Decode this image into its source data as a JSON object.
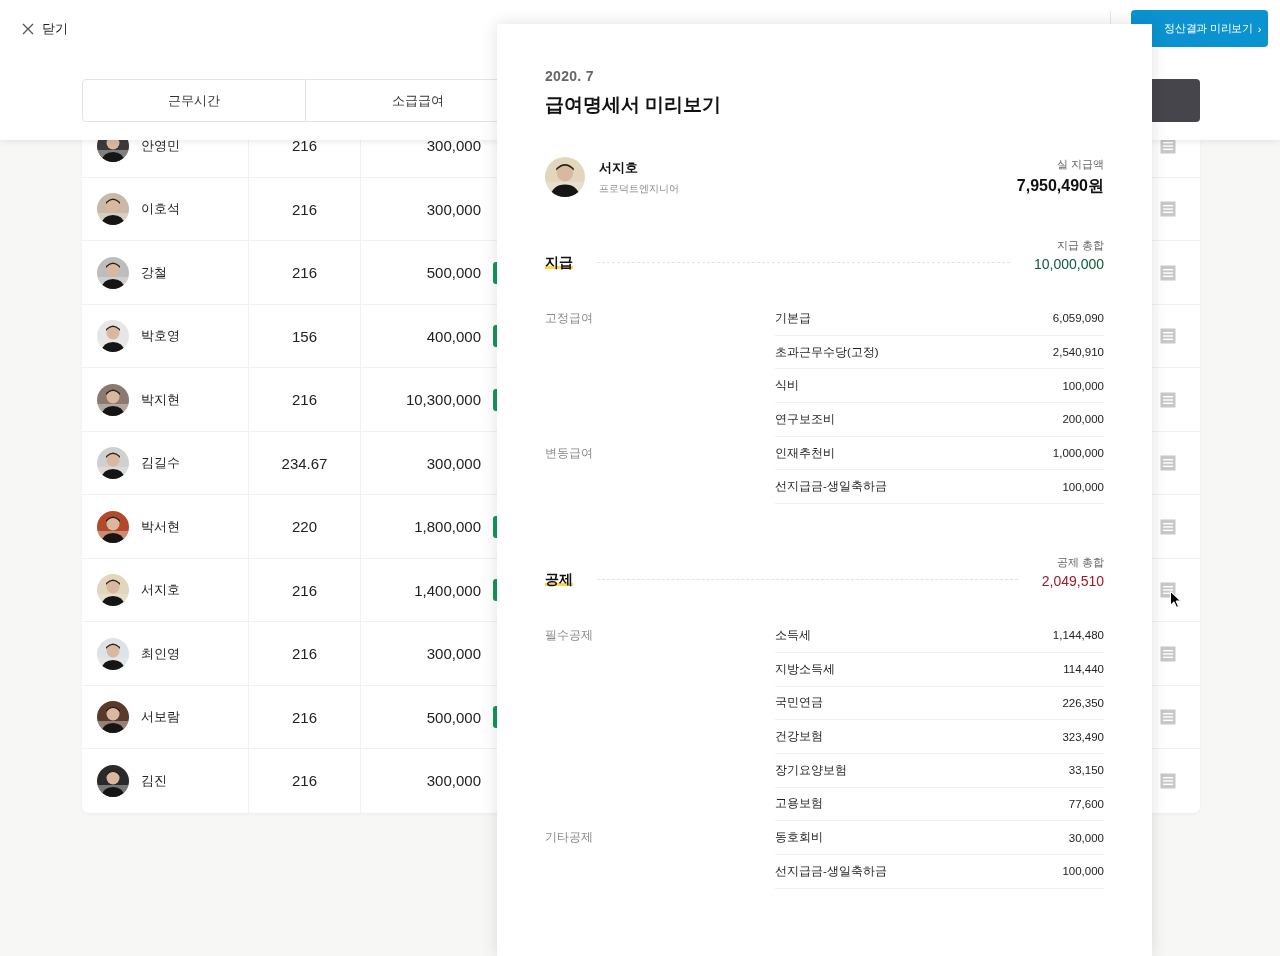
{
  "header": {
    "close_label": "닫기",
    "tabs": [
      "근무시간",
      "소급급여"
    ],
    "preview_button": "정산결과 미리보기",
    "preview_chevron": "›"
  },
  "rows": [
    {
      "name": "안영민",
      "hours": "216",
      "amount": "300,000",
      "badge": false
    },
    {
      "name": "이호석",
      "hours": "216",
      "amount": "300,000",
      "badge": false
    },
    {
      "name": "강철",
      "hours": "216",
      "amount": "500,000",
      "badge": true
    },
    {
      "name": "박호영",
      "hours": "156",
      "amount": "400,000",
      "badge": true
    },
    {
      "name": "박지현",
      "hours": "216",
      "amount": "10,300,000",
      "badge": true
    },
    {
      "name": "김길수",
      "hours": "234.67",
      "amount": "300,000",
      "badge": false
    },
    {
      "name": "박서현",
      "hours": "220",
      "amount": "1,800,000",
      "badge": true
    },
    {
      "name": "서지호",
      "hours": "216",
      "amount": "1,400,000",
      "badge": true
    },
    {
      "name": "최인영",
      "hours": "216",
      "amount": "300,000",
      "badge": false
    },
    {
      "name": "서보람",
      "hours": "216",
      "amount": "500,000",
      "badge": true
    },
    {
      "name": "김진",
      "hours": "216",
      "amount": "300,000",
      "badge": false
    }
  ],
  "payslip": {
    "period": "2020. 7",
    "title": "급여명세서 미리보기",
    "employee": {
      "name": "서지호",
      "role": "프로덕트엔지니어"
    },
    "net_label": "실 지급액",
    "net_amount": "7,950,490원",
    "sections": [
      {
        "title": "지급",
        "total_label": "지급 총합",
        "total": "10,000,000",
        "color": "#0b5a3a",
        "groups": [
          {
            "label": "고정급여",
            "items": [
              {
                "name": "기본급",
                "amount": "6,059,090"
              },
              {
                "name": "초과근무수당(고정)",
                "amount": "2,540,910"
              },
              {
                "name": "식비",
                "amount": "100,000"
              },
              {
                "name": "연구보조비",
                "amount": "200,000"
              }
            ]
          },
          {
            "label": "변동급여",
            "items": [
              {
                "name": "인재추천비",
                "amount": "1,000,000"
              },
              {
                "name": "선지급금-생일축하금",
                "amount": "100,000"
              }
            ]
          }
        ]
      },
      {
        "title": "공제",
        "total_label": "공제 총합",
        "total": "2,049,510",
        "color": "#a3172b",
        "groups": [
          {
            "label": "필수공제",
            "items": [
              {
                "name": "소득세",
                "amount": "1,144,480"
              },
              {
                "name": "지방소득세",
                "amount": "114,440"
              },
              {
                "name": "국민연금",
                "amount": "226,350"
              },
              {
                "name": "건강보험",
                "amount": "323,490"
              },
              {
                "name": "장기요양보험",
                "amount": "33,150"
              },
              {
                "name": "고용보험",
                "amount": "77,600"
              }
            ]
          },
          {
            "label": "기타공제",
            "items": [
              {
                "name": "동호회비",
                "amount": "30,000"
              },
              {
                "name": "선지급금-생일축하금",
                "amount": "100,000"
              }
            ]
          }
        ]
      }
    ]
  }
}
